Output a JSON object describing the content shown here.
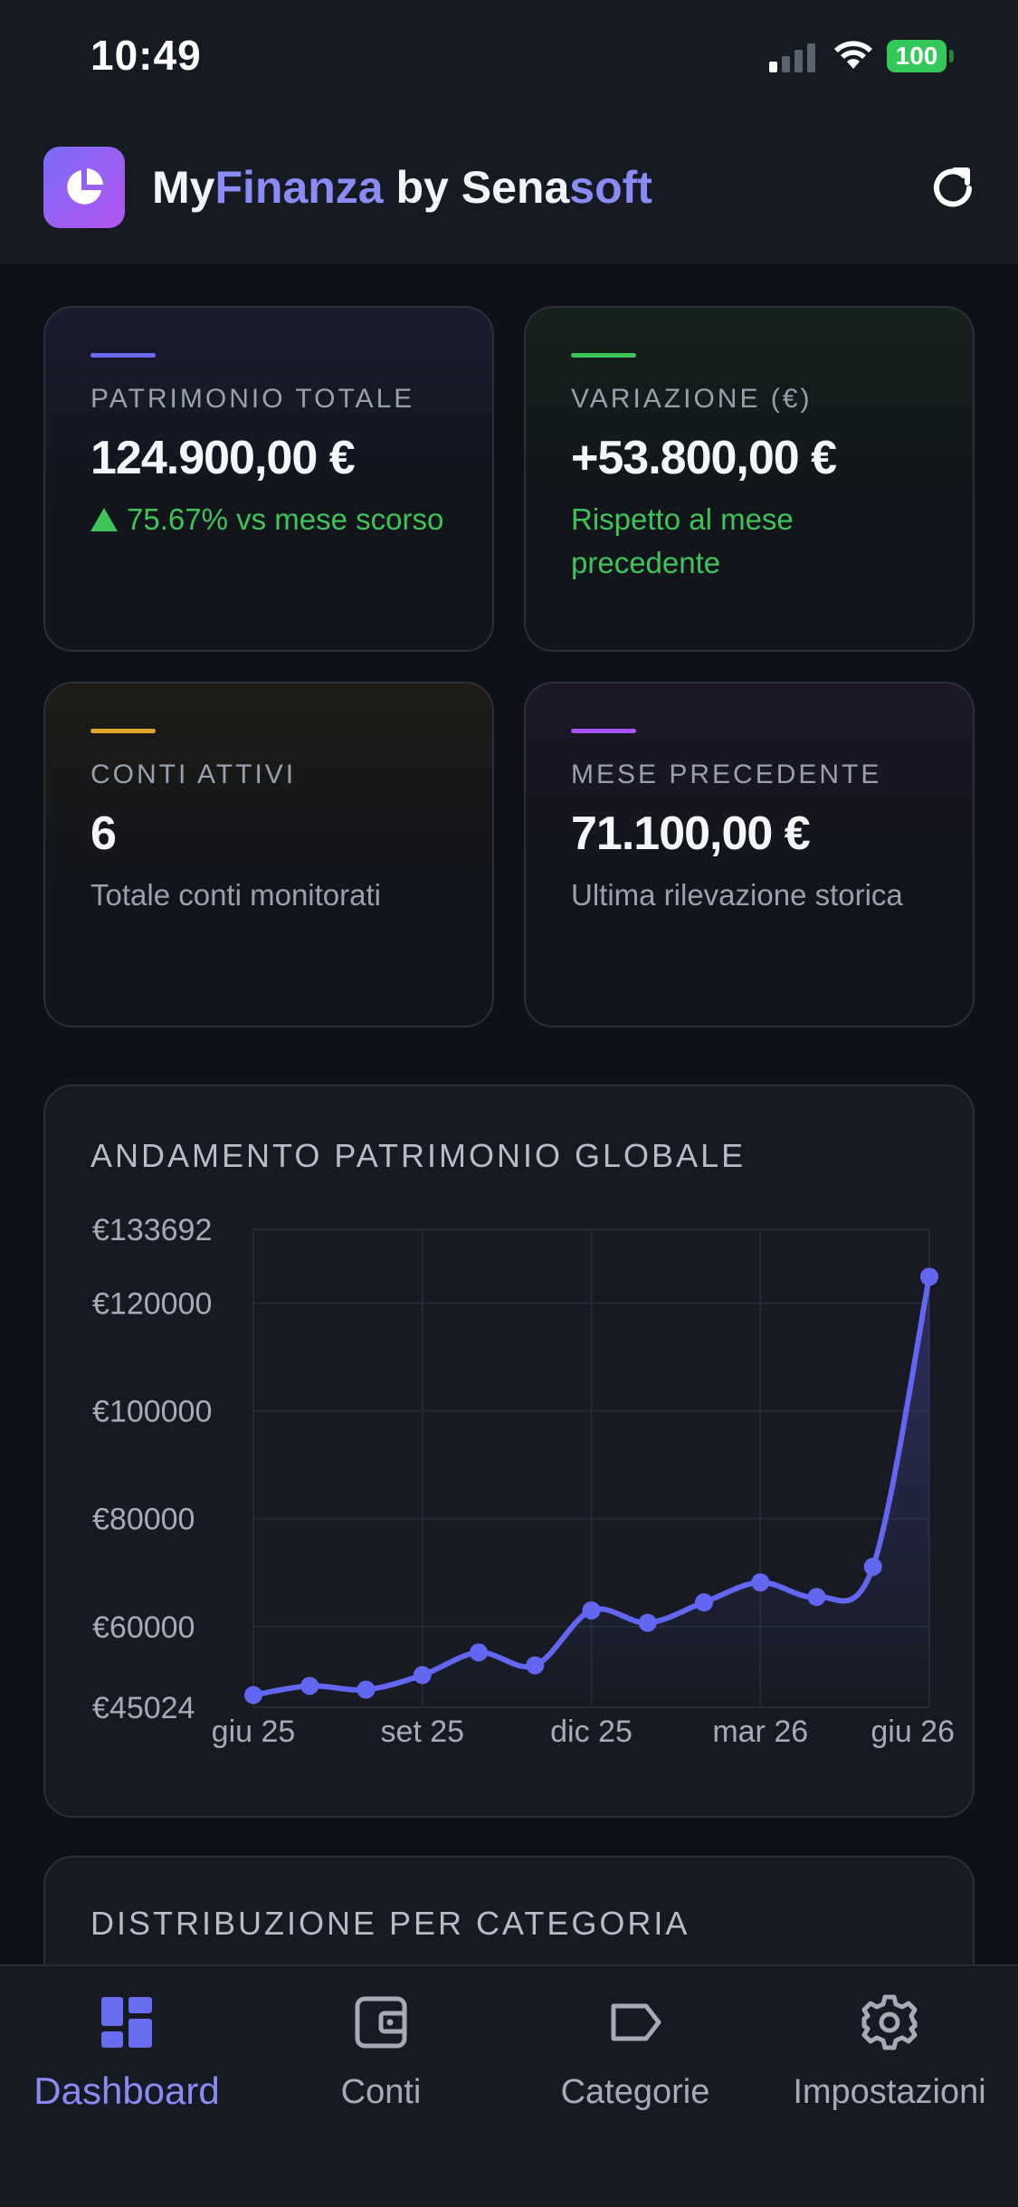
{
  "status_bar": {
    "time": "10:49",
    "battery": "100"
  },
  "header": {
    "brand_part1": "My",
    "brand_part2": "Finanza",
    "brand_part3": " by ",
    "brand_part4": "Sena",
    "brand_part5": "soft"
  },
  "stats": [
    {
      "label": "PATRIMONIO TOTALE",
      "value": "124.900,00 €",
      "sub": "75.67% vs mese scorso",
      "accent": "#6a6cf0"
    },
    {
      "label": "VARIAZIONE (€)",
      "value": "+53.800,00 €",
      "sub": "Rispetto al mese precedente",
      "accent": "#3fc45a"
    },
    {
      "label": "CONTI ATTIVI",
      "value": "6",
      "sub": "Totale conti monitorati",
      "accent": "#e0a52a"
    },
    {
      "label": "MESE PRECEDENTE",
      "value": "71.100,00 €",
      "sub": "Ultima rilevazione storica",
      "accent": "#a855f7"
    }
  ],
  "chart_data": {
    "type": "line",
    "title": "ANDAMENTO PATRIMONIO GLOBALE",
    "x": [
      "giu 25",
      "lug 25",
      "ago 25",
      "set 25",
      "ott 25",
      "nov 25",
      "dic 25",
      "gen 26",
      "feb 26",
      "mar 26",
      "apr 26",
      "mag 26",
      "giu 26"
    ],
    "values": [
      47300,
      49000,
      48300,
      51000,
      55200,
      52800,
      63000,
      60700,
      64500,
      68200,
      65500,
      71100,
      124900
    ],
    "ylim": [
      45024,
      133692
    ],
    "y_ticks": [
      "€133692",
      "€120000",
      "€100000",
      "€80000",
      "€60000",
      "€45024"
    ],
    "y_tick_values": [
      133692,
      120000,
      100000,
      80000,
      60000,
      45024
    ],
    "x_tick_labels": [
      "giu 25",
      "set 25",
      "dic 25",
      "mar 26",
      "giu 26"
    ],
    "x_tick_index": [
      0,
      3,
      6,
      9,
      12
    ],
    "grid": true,
    "line_color": "#6366f1"
  },
  "distribution": {
    "title": "DISTRIBUZIONE PER CATEGORIA"
  },
  "nav": [
    {
      "label": "Dashboard",
      "icon": "dashboard-icon"
    },
    {
      "label": "Conti",
      "icon": "wallet-icon"
    },
    {
      "label": "Categorie",
      "icon": "tag-icon"
    },
    {
      "label": "Impostazioni",
      "icon": "gear-icon"
    }
  ]
}
